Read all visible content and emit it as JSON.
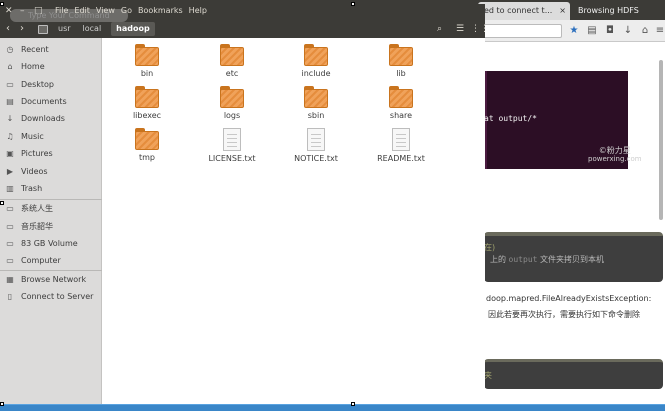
{
  "browser": {
    "tabs": [
      {
        "label": "ed to connect t...",
        "close": "×"
      },
      {
        "label": "Browsing HDFS"
      }
    ],
    "terminal1_text": "at output/*",
    "watermark_line1": "©粉力星",
    "watermark_line2": "powerxing.com",
    "terminal2_line1": "在)",
    "terminal2_line2_pre": "上的",
    "terminal2_line2_mono": "output",
    "terminal2_line2_post": "文件夹拷贝到本机",
    "para_line1": "doop.mapred.FileAlreadyExistsException:",
    "para_line2": "因此若要再次执行，需要执行如下命令删除",
    "terminal3_text": "夹"
  },
  "fm": {
    "menu": [
      "File",
      "Edit",
      "View",
      "Go",
      "Bookmarks",
      "Help"
    ],
    "search_placeholder": "Type Your Command",
    "breadcrumb": [
      "usr",
      "local",
      "hadoop"
    ],
    "sidebar": [
      {
        "icon": "clock-icon",
        "glyph": "◷",
        "label": "Recent"
      },
      {
        "icon": "home-icon",
        "glyph": "⌂",
        "label": "Home"
      },
      {
        "icon": "desktop-icon",
        "glyph": "▭",
        "label": "Desktop"
      },
      {
        "icon": "documents-icon",
        "glyph": "▤",
        "label": "Documents"
      },
      {
        "icon": "downloads-icon",
        "glyph": "↓",
        "label": "Downloads"
      },
      {
        "icon": "music-icon",
        "glyph": "♫",
        "label": "Music"
      },
      {
        "icon": "pictures-icon",
        "glyph": "▣",
        "label": "Pictures"
      },
      {
        "icon": "videos-icon",
        "glyph": "▶",
        "label": "Videos"
      },
      {
        "icon": "trash-icon",
        "glyph": "▥",
        "label": "Trash"
      },
      {
        "icon": "drive-icon",
        "glyph": "▭",
        "label": "系统人生"
      },
      {
        "icon": "drive-icon",
        "glyph": "▭",
        "label": "音乐韶华"
      },
      {
        "icon": "drive-icon",
        "glyph": "▭",
        "label": "83 GB Volume"
      },
      {
        "icon": "computer-icon",
        "glyph": "▭",
        "label": "Computer"
      },
      {
        "icon": "network-icon",
        "glyph": "▦",
        "label": "Browse Network"
      },
      {
        "icon": "server-icon",
        "glyph": "▯",
        "label": "Connect to Server"
      }
    ],
    "files": [
      {
        "name": "bin",
        "type": "folder"
      },
      {
        "name": "etc",
        "type": "folder"
      },
      {
        "name": "include",
        "type": "folder"
      },
      {
        "name": "lib",
        "type": "folder"
      },
      {
        "name": "libexec",
        "type": "folder"
      },
      {
        "name": "logs",
        "type": "folder"
      },
      {
        "name": "sbin",
        "type": "folder"
      },
      {
        "name": "share",
        "type": "folder"
      },
      {
        "name": "tmp",
        "type": "folder"
      },
      {
        "name": "LICENSE.txt",
        "type": "file"
      },
      {
        "name": "NOTICE.txt",
        "type": "file"
      },
      {
        "name": "README.txt",
        "type": "file"
      }
    ]
  }
}
